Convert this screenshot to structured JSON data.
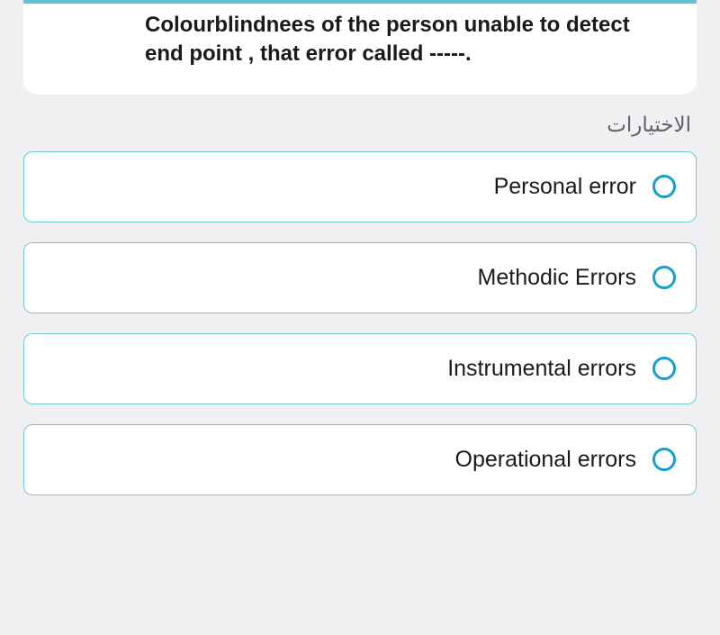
{
  "question": {
    "text": "Colourblindnees of the person unable to detect end point , that error called -----."
  },
  "choices_label": "الاختيارات",
  "options": [
    {
      "label": "Personal error"
    },
    {
      "label": "Methodic Errors"
    },
    {
      "label": "Instrumental errors"
    },
    {
      "label": "Operational errors"
    }
  ]
}
